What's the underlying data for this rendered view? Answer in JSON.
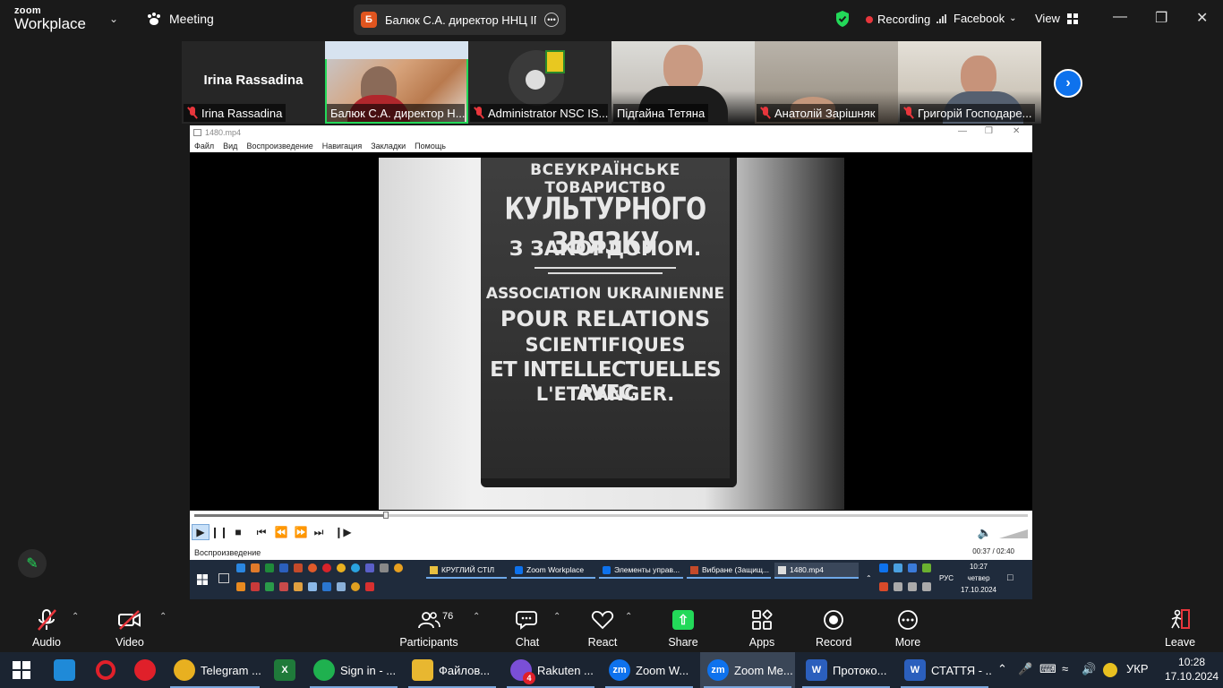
{
  "zoom_top": {
    "logo_line1": "zoom",
    "logo_line2": "Workplace",
    "meeting_label": "Meeting",
    "speaker_badge": "Б",
    "speaker_name": "Балюк С.А. директор ННЦ ІГА і",
    "recording_label": "Recording",
    "facebook_label": "Facebook",
    "view_label": "View"
  },
  "participants_strip": [
    {
      "name": "Irina Rassadina",
      "big_label": "Irina Rassadina",
      "muted": true
    },
    {
      "name": "Балюк С.А. директор Н...",
      "muted": true,
      "active": true
    },
    {
      "name": "Administrator NSC IS...",
      "muted": true
    },
    {
      "name": "Підгайна Тетяна",
      "muted": false
    },
    {
      "name": "Анатолій Зарішняк",
      "muted": true
    },
    {
      "name": "Григорій Господаре...",
      "muted": true
    }
  ],
  "player": {
    "window_title": "1480.mp4",
    "menu": [
      "Файл",
      "Вид",
      "Воспроизведение",
      "Навигация",
      "Закладки",
      "Помощь"
    ],
    "status_text": "Воспроизведение",
    "time_text": "00:37 / 02:40",
    "progress_fraction": 0.23,
    "plaque_lines": [
      "ВСЕУКРАЇНСЬКЕ",
      "ТОВАРИСТВО",
      "КУЛЬТУРНОГО ЗВЯЗКУ",
      "З ЗАКОРДОНОМ.",
      "ASSOCIATION UKRAINIENNE",
      "POUR RELATIONS",
      "SCIENTIFIQUES",
      "ET INTELLECTUELLES AVEC",
      "L'ETRANGER."
    ]
  },
  "remote_taskbar": {
    "apps": [
      "КРУГЛИЙ СТІЛ",
      "Zoom Workplace",
      "Элементы управ...",
      "Вибране (Защищ...",
      "1480.mp4"
    ],
    "lang": "РУС",
    "time": "10:27",
    "day": "четвер",
    "date": "17.10.2024"
  },
  "zoom_toolbar": {
    "audio": "Audio",
    "video": "Video",
    "participants": "Participants",
    "participants_count": "76",
    "chat": "Chat",
    "react": "React",
    "share": "Share",
    "apps": "Apps",
    "record": "Record",
    "more": "More",
    "leave": "Leave"
  },
  "win_taskbar": {
    "apps": [
      {
        "label": "Telegram ...",
        "color": "#2aa3e0"
      },
      {
        "label": "Sign in - ...",
        "color": "#1fb14f"
      },
      {
        "label": "Файлов...",
        "color": "#e8b730"
      },
      {
        "label": "Rakuten ...",
        "color": "#7a4fd6",
        "badge": "4"
      },
      {
        "label": "Zoom W...",
        "color": "#0e72ed"
      },
      {
        "label": "Zoom Me...",
        "color": "#0e72ed"
      },
      {
        "label": "Протоко...",
        "color": "#2b5fbd"
      },
      {
        "label": "СТАТТЯ - ...",
        "color": "#2b5fbd"
      }
    ],
    "lang": "УКР",
    "time": "10:28",
    "date": "17.10.2024"
  }
}
